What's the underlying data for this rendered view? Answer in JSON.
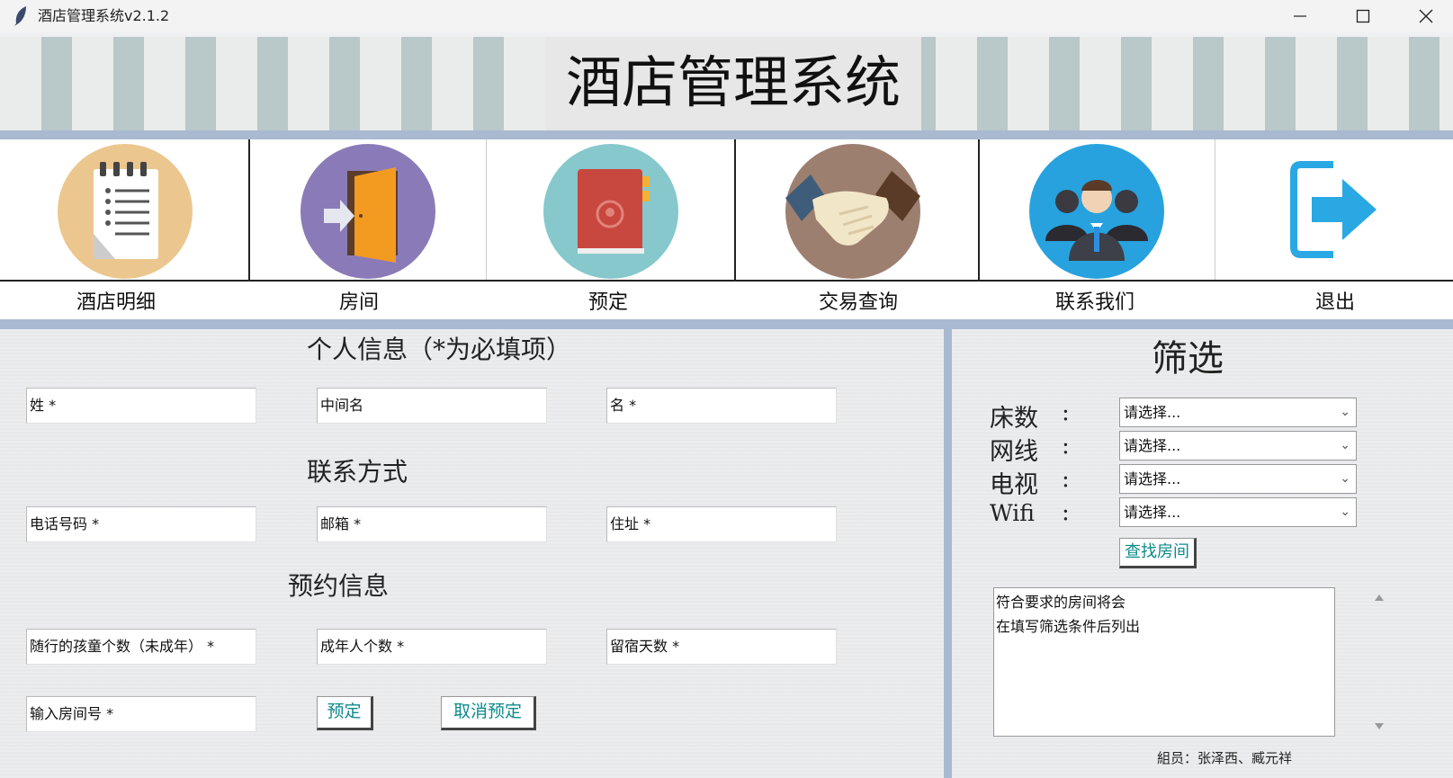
{
  "window": {
    "title": "酒店管理系统v2.1.2",
    "controls": [
      "minimize",
      "maximize",
      "close"
    ]
  },
  "banner": {
    "title": "酒店管理系统"
  },
  "nav": {
    "items": [
      {
        "label": "酒店明细",
        "icon": "notepad-icon",
        "color": "#ebc78f"
      },
      {
        "label": "房间",
        "icon": "door-icon",
        "color": "#8a7bb8"
      },
      {
        "label": "预定",
        "icon": "book-icon",
        "color": "#86c8cc"
      },
      {
        "label": "交易查询",
        "icon": "handshake-icon",
        "color": "#9d7f70"
      },
      {
        "label": "联系我们",
        "icon": "team-icon",
        "color": "#27a2de"
      },
      {
        "label": "退出",
        "icon": "exit-icon",
        "color": "#29a8e4"
      }
    ]
  },
  "form": {
    "personal_title": "个人信息（*为必填项）",
    "last_name": "姓 *",
    "middle_name": "中间名",
    "first_name": "名 *",
    "contact_title": "联系方式",
    "phone": "电话号码 *",
    "email": "邮箱 *",
    "address": "住址 *",
    "booking_title": "预约信息",
    "children": "随行的孩童个数（未成年） *",
    "adults": "成年人个数 *",
    "nights": "留宿天数 *",
    "room_number": "输入房间号 *",
    "book_button": "预定",
    "cancel_button": "取消预定"
  },
  "filter": {
    "title": "筛选",
    "rows": [
      {
        "label": "床数",
        "value": "请选择..."
      },
      {
        "label": "网线",
        "value": "请选择..."
      },
      {
        "label": "电视",
        "value": "请选择..."
      },
      {
        "label": "Wifi",
        "value": "请选择..."
      }
    ],
    "colon": ":",
    "search_button": "查找房间",
    "results_line1": "符合要求的房间将会",
    "results_line2": "在填写筛选条件后列出"
  },
  "footer": {
    "credits": "組员：张泽西、臧元祥"
  },
  "accent": "#a9b9d2",
  "button_text_color": "#0e8a8a"
}
